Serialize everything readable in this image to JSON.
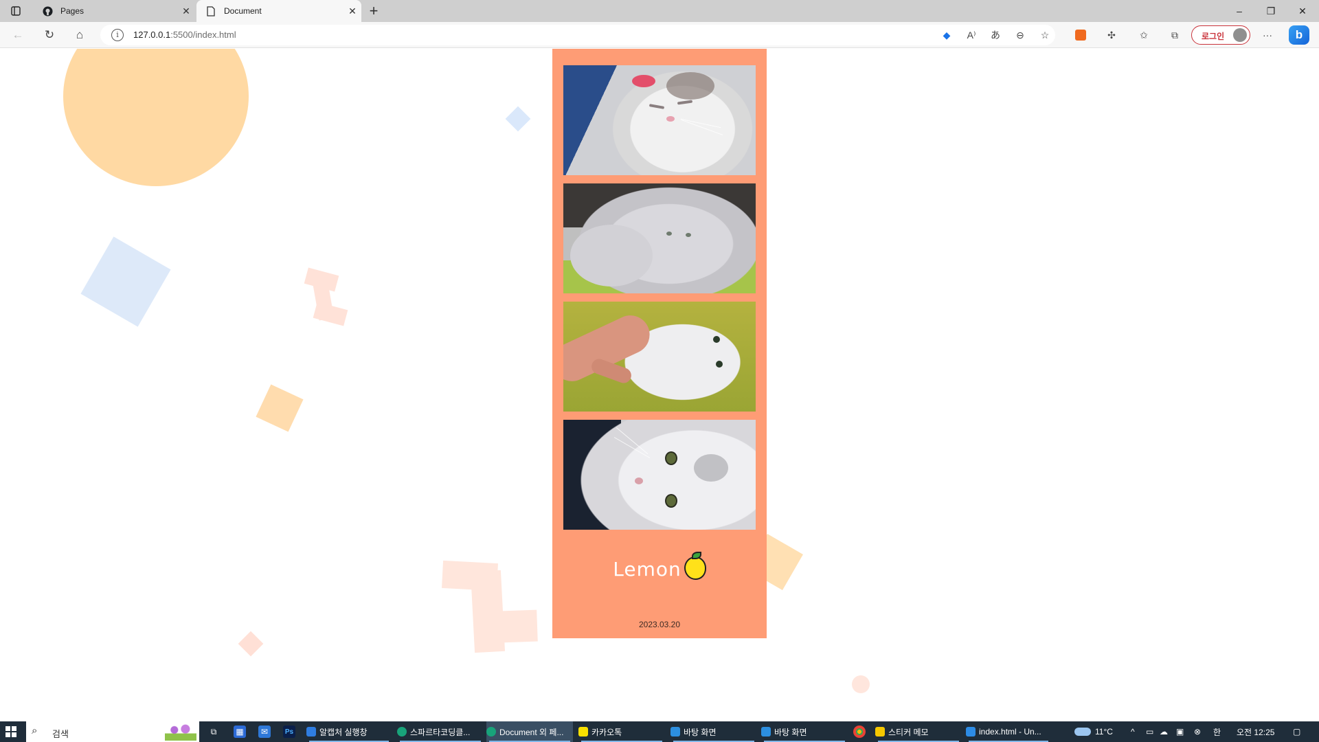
{
  "browser": {
    "tabs": [
      {
        "title": "Pages",
        "icon": "github-icon"
      },
      {
        "title": "Document",
        "icon": "page-icon"
      }
    ],
    "url_host": "127.0.0.1",
    "url_rest": ":5500/index.html",
    "login_label": "로그인",
    "bing_label": "b"
  },
  "page": {
    "background": "#ffffff",
    "strip_color": "#fe9c75",
    "photos": [
      {
        "alt": "white cat sleeping with paw raised"
      },
      {
        "alt": "white cat lying on green blanket"
      },
      {
        "alt": "hand petting white cat on yellow-green blanket"
      },
      {
        "alt": "white cat close-up looking up"
      }
    ],
    "title": "Lemon",
    "title_icon": "lemon-icon",
    "date": "2023.03.20"
  },
  "taskbar": {
    "search_placeholder": "검색",
    "apps": [
      {
        "label": "알캡처 실행창",
        "color": "#2f7de1"
      },
      {
        "label": "스파르타코딩클...",
        "color": "#18a37a"
      },
      {
        "label": "Document 외 페...",
        "color": "#18a37a"
      },
      {
        "label": "카카오톡",
        "color": "#f9e000"
      },
      {
        "label": "바탕 화면",
        "color": "#2c8fe0"
      },
      {
        "label": "바탕 화면",
        "color": "#2c8fe0"
      },
      {
        "label": "스티커 메모",
        "color": "#f6c800"
      },
      {
        "label": "index.html - Un...",
        "color": "#2d8ce6"
      }
    ],
    "weather": "11°C",
    "time": "오전 12:25",
    "ime": "한"
  }
}
